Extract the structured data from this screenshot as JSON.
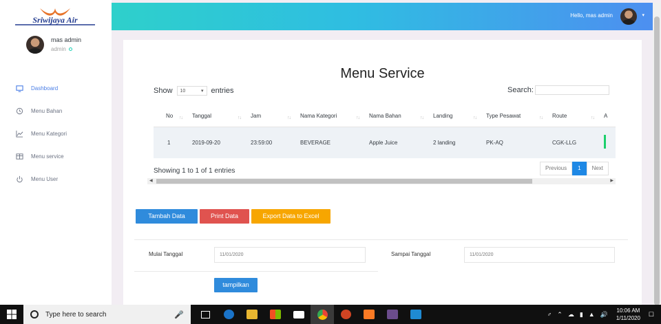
{
  "brand": {
    "logo_text": "Sriwijaya Air"
  },
  "profile": {
    "name": "mas admin",
    "role": "admin"
  },
  "nav": [
    {
      "label": "Dashboard",
      "icon": "monitor-icon",
      "active": true
    },
    {
      "label": "Menu Bahan",
      "icon": "history-icon",
      "active": false
    },
    {
      "label": "Menu Kategori",
      "icon": "chart-line-icon",
      "active": false
    },
    {
      "label": "Menu service",
      "icon": "table-icon",
      "active": false
    },
    {
      "label": "Menu User",
      "icon": "power-icon",
      "active": false
    }
  ],
  "topbar": {
    "greeting": "Hello, mas admin"
  },
  "page": {
    "title": "Menu Service"
  },
  "table_controls": {
    "show_label": "Show",
    "entries_value": "10",
    "entries_label": "entries",
    "search_label": "Search:"
  },
  "table": {
    "columns": [
      "No",
      "Tanggal",
      "Jam",
      "Nama Kategori",
      "Nama Bahan",
      "Landing",
      "Type Pesawat",
      "Route",
      "A"
    ],
    "rows": [
      [
        "1",
        "2019-09-20",
        "23:59:00",
        "BEVERAGE",
        "Apple Juice",
        "2 landing",
        "PK-AQ",
        "CGK-LLG",
        ""
      ]
    ],
    "info": "Showing 1 to 1 of 1 entries",
    "pager": {
      "prev": "Previous",
      "page": "1",
      "next": "Next"
    }
  },
  "actions": {
    "add": "Tambah Data",
    "print": "Print Data",
    "excel": "Export Data to Excel"
  },
  "filter": {
    "start_label": "Mulai Tanggal",
    "start_value": "11/01/2020",
    "end_label": "Sampai Tanggal",
    "end_value": "11/01/2020",
    "submit": "tampilkan"
  },
  "taskbar": {
    "search_placeholder": "Type here to search",
    "time": "10:06 AM",
    "date": "1/11/2020"
  },
  "colors": {
    "accent": "#4a7ee6",
    "primary_btn": "#2f8bdc",
    "danger_btn": "#e0534f",
    "warning_btn": "#f7a600"
  }
}
